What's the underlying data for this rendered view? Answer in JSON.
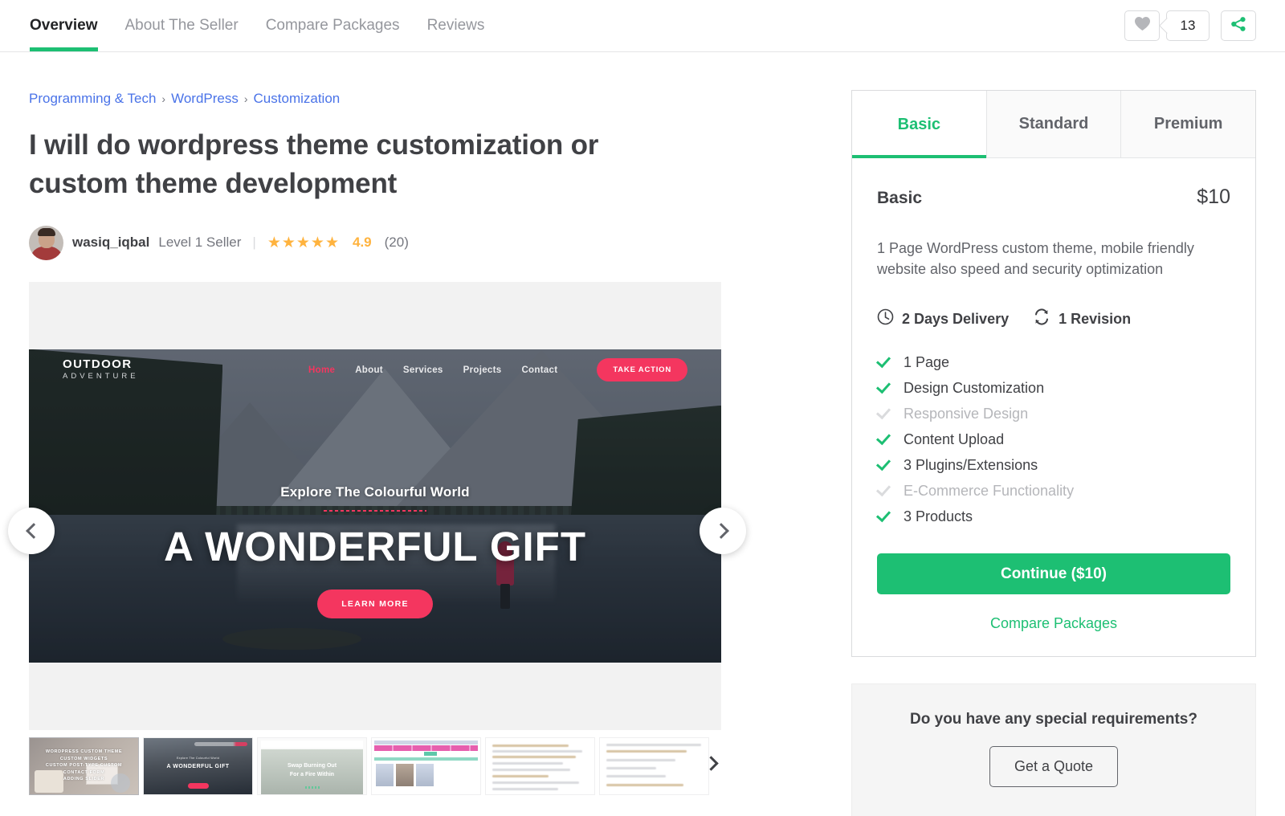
{
  "nav": {
    "tabs": [
      {
        "label": "Overview",
        "active": true
      },
      {
        "label": "About The Seller",
        "active": false
      },
      {
        "label": "Compare Packages",
        "active": false
      },
      {
        "label": "Reviews",
        "active": false
      }
    ],
    "collect_count": "13",
    "heart_icon": "heart-icon",
    "share_icon": "share-icon"
  },
  "breadcrumb": {
    "items": [
      "Programming & Tech",
      "WordPress",
      "Customization"
    ],
    "separator": "›"
  },
  "gig": {
    "title": "I will do wordpress theme customization or custom theme development",
    "seller": {
      "name": "wasiq_iqbal",
      "level": "Level 1 Seller",
      "stars": "★★★★★",
      "rating": "4.9",
      "reviews": "(20)"
    }
  },
  "gallery": {
    "prev_label": "‹",
    "next_label": "›",
    "slide": {
      "brand_line1": "OUTDOOR",
      "brand_line2": "ADVENTURE",
      "links": [
        "Home",
        "About",
        "Services",
        "Projects",
        "Contact"
      ],
      "cta": "TAKE ACTION",
      "kicker": "Explore The Colourful World",
      "headline": "A WONDERFUL GIFT",
      "button": "LEARN MORE"
    },
    "thumbnails": [
      {
        "caption": "WORDPRESS CUSTOM THEME\nCUSTOM WIDGETS\nCUSTOM POST-TYPE CUSTOM\nCONTACT FORM\nADDING SLIDER"
      },
      {
        "caption": "A WONDERFUL GIFT",
        "sub": "Explore The Colourful World"
      },
      {
        "caption": "Swap Burning Out\nFor a Fire Within"
      },
      {
        "caption": ""
      },
      {
        "caption": ""
      },
      {
        "caption": ""
      }
    ]
  },
  "package": {
    "tabs": [
      {
        "label": "Basic",
        "active": true
      },
      {
        "label": "Standard",
        "active": false
      },
      {
        "label": "Premium",
        "active": false
      }
    ],
    "name": "Basic",
    "price": "$10",
    "description": "1 Page WordPress custom theme, mobile friendly website also speed and security optimization",
    "delivery": "2 Days Delivery",
    "revisions": "1 Revision",
    "features": [
      {
        "label": "1 Page",
        "included": true
      },
      {
        "label": "Design Customization",
        "included": true
      },
      {
        "label": "Responsive Design",
        "included": false
      },
      {
        "label": "Content Upload",
        "included": true
      },
      {
        "label": "3 Plugins/Extensions",
        "included": true
      },
      {
        "label": "E-Commerce Functionality",
        "included": false
      },
      {
        "label": "3 Products",
        "included": true
      }
    ],
    "continue_label": "Continue ($10)",
    "compare_label": "Compare Packages"
  },
  "requirements": {
    "title": "Do you have any special requirements?",
    "button": "Get a Quote"
  },
  "colors": {
    "brand_green": "#1dbf73",
    "link_blue": "#4a73e8",
    "star_gold": "#ffb33e",
    "accent_pink": "#f4365f"
  }
}
